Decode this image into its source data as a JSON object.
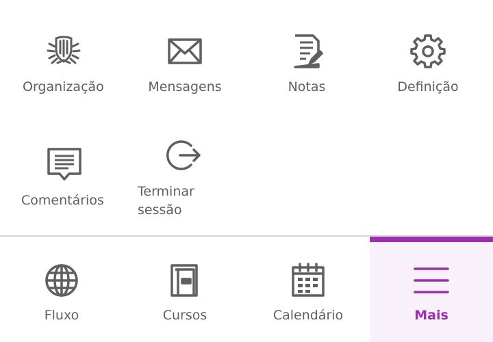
{
  "menu": {
    "items": [
      {
        "label": "Organização",
        "icon": "organization-crest-icon"
      },
      {
        "label": "Mensagens",
        "icon": "envelope-icon"
      },
      {
        "label": "Notas",
        "icon": "notes-document-icon"
      },
      {
        "label": "Definição",
        "icon": "gear-icon"
      },
      {
        "label": "Comentários",
        "icon": "comment-icon"
      },
      {
        "label": "Terminar sessão",
        "icon": "logout-icon"
      }
    ]
  },
  "tabbar": {
    "tabs": [
      {
        "label": "Fluxo",
        "icon": "globe-icon"
      },
      {
        "label": "Cursos",
        "icon": "book-icon"
      },
      {
        "label": "Calendário",
        "icon": "calendar-icon"
      },
      {
        "label": "Mais",
        "icon": "hamburger-menu-icon",
        "active": true
      }
    ]
  },
  "colors": {
    "accent": "#9b2fae",
    "icon": "#5f5f5f",
    "active_bg": "#f8f0fa",
    "divider": "#d6d6d6"
  }
}
